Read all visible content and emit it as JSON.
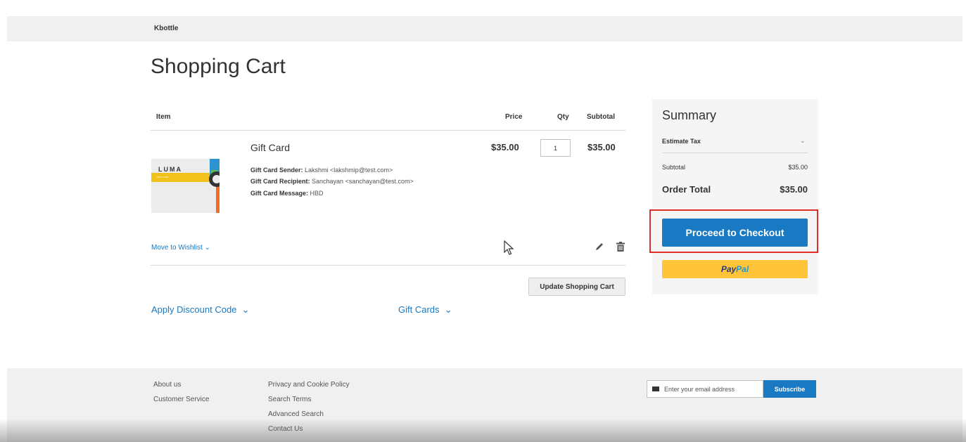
{
  "header": {
    "store_name": "Kbottle"
  },
  "page": {
    "title": "Shopping Cart"
  },
  "cart": {
    "columns": {
      "item": "Item",
      "price": "Price",
      "qty": "Qty",
      "subtotal": "Subtotal"
    },
    "item": {
      "name": "Gift Card",
      "image_brand": "LUMA",
      "image_caption": "GIFT CARD",
      "options": [
        {
          "label": "Gift Card Sender:",
          "value": "Lakshmi <lakshmip@test.com>"
        },
        {
          "label": "Gift Card Recipient:",
          "value": "Sanchayan <sanchayan@test.com>"
        },
        {
          "label": "Gift Card Message:",
          "value": "HBD"
        }
      ],
      "price": "$35.00",
      "qty": "1",
      "subtotal": "$35.00"
    },
    "move_to_wishlist": "Move to Wishlist",
    "update_button": "Update Shopping Cart",
    "apply_discount": "Apply Discount Code",
    "gift_cards": "Gift Cards"
  },
  "summary": {
    "title": "Summary",
    "estimate_tax": "Estimate Tax",
    "subtotal_label": "Subtotal",
    "subtotal_value": "$35.00",
    "order_total_label": "Order Total",
    "order_total_value": "$35.00",
    "checkout_button": "Proceed to Checkout",
    "paypal_a": "Pay",
    "paypal_b": "Pal"
  },
  "footer": {
    "col1": [
      "About us",
      "Customer Service"
    ],
    "col2": [
      "Privacy and Cookie Policy",
      "Search Terms",
      "Advanced Search",
      "Contact Us"
    ],
    "newsletter_placeholder": "Enter your email address",
    "subscribe_button": "Subscribe"
  },
  "colors": {
    "accent": "#1979c3",
    "paypal": "#ffc439",
    "highlight": "#e02b27"
  }
}
